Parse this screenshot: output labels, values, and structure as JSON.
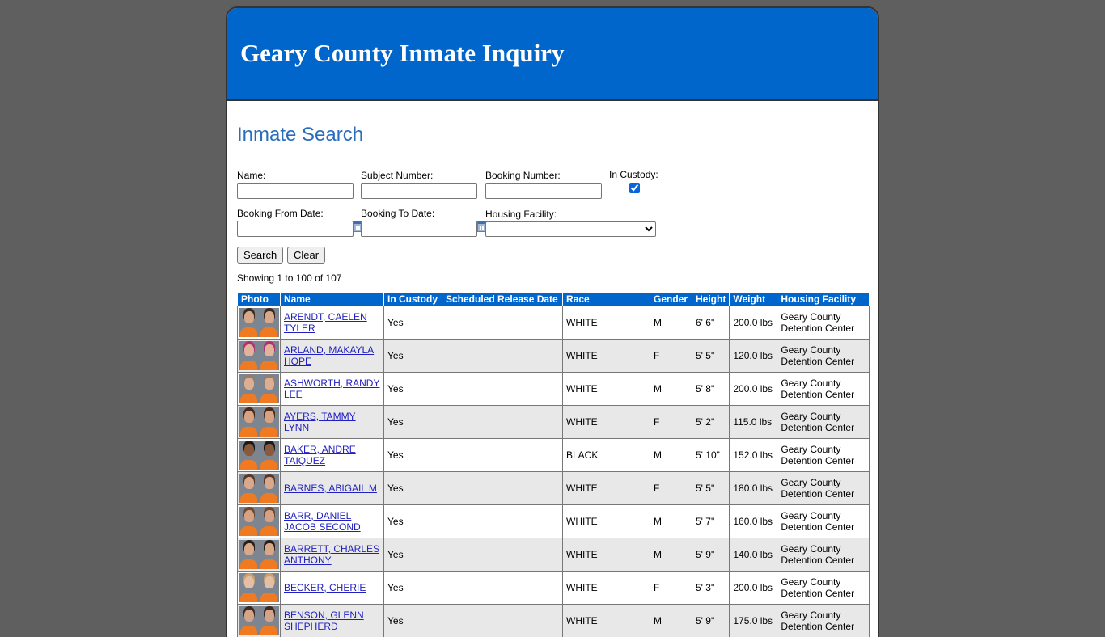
{
  "header": {
    "title": "Geary County Inmate Inquiry"
  },
  "search": {
    "title": "Inmate Search",
    "name_label": "Name:",
    "name_value": "",
    "subject_label": "Subject Number:",
    "subject_value": "",
    "booking_number_label": "Booking Number:",
    "booking_number_value": "",
    "in_custody_label": "In Custody:",
    "in_custody_checked": true,
    "from_date_label": "Booking From Date:",
    "from_date_value": "",
    "to_date_label": "Booking To Date:",
    "to_date_value": "",
    "facility_label": "Housing Facility:",
    "facility_selected": "",
    "search_button": "Search",
    "clear_button": "Clear"
  },
  "results": {
    "summary": "Showing 1 to 100 of 107",
    "columns": [
      "Photo",
      "Name",
      "In Custody",
      "Scheduled Release Date",
      "Race",
      "Gender",
      "Height",
      "Weight",
      "Housing Facility"
    ],
    "rows": [
      {
        "name": "ARENDT, CAELEN TYLER",
        "custody": "Yes",
        "release": "",
        "race": "WHITE",
        "gender": "M",
        "height": "6' 6\"",
        "weight": "200.0 lbs",
        "facility": "Geary County Detention Center"
      },
      {
        "name": "ARLAND, MAKAYLA HOPE",
        "custody": "Yes",
        "release": "",
        "race": "WHITE",
        "gender": "F",
        "height": "5' 5\"",
        "weight": "120.0 lbs",
        "facility": "Geary County Detention Center"
      },
      {
        "name": "ASHWORTH, RANDY LEE",
        "custody": "Yes",
        "release": "",
        "race": "WHITE",
        "gender": "M",
        "height": "5' 8\"",
        "weight": "200.0 lbs",
        "facility": "Geary County Detention Center"
      },
      {
        "name": "AYERS, TAMMY LYNN",
        "custody": "Yes",
        "release": "",
        "race": "WHITE",
        "gender": "F",
        "height": "5' 2\"",
        "weight": "115.0 lbs",
        "facility": "Geary County Detention Center"
      },
      {
        "name": "BAKER, ANDRE TAIQUEZ",
        "custody": "Yes",
        "release": "",
        "race": "BLACK",
        "gender": "M",
        "height": "5' 10\"",
        "weight": "152.0 lbs",
        "facility": "Geary County Detention Center"
      },
      {
        "name": "BARNES, ABIGAIL M",
        "custody": "Yes",
        "release": "",
        "race": "WHITE",
        "gender": "F",
        "height": "5' 5\"",
        "weight": "180.0 lbs",
        "facility": "Geary County Detention Center"
      },
      {
        "name": "BARR, DANIEL JACOB SECOND",
        "custody": "Yes",
        "release": "",
        "race": "WHITE",
        "gender": "M",
        "height": "5' 7\"",
        "weight": "160.0 lbs",
        "facility": "Geary County Detention Center"
      },
      {
        "name": "BARRETT, CHARLES ANTHONY",
        "custody": "Yes",
        "release": "",
        "race": "WHITE",
        "gender": "M",
        "height": "5' 9\"",
        "weight": "140.0 lbs",
        "facility": "Geary County Detention Center"
      },
      {
        "name": "BECKER, CHERIE",
        "custody": "Yes",
        "release": "",
        "race": "WHITE",
        "gender": "F",
        "height": "5' 3\"",
        "weight": "200.0 lbs",
        "facility": "Geary County Detention Center"
      },
      {
        "name": "BENSON, GLENN SHEPHERD",
        "custody": "Yes",
        "release": "",
        "race": "WHITE",
        "gender": "M",
        "height": "5' 9\"",
        "weight": "175.0 lbs",
        "facility": "Geary County Detention Center"
      }
    ]
  },
  "colors": {
    "header_bg": "#0066cc",
    "title_blue": "#2a6ebb",
    "page_bg": "#5f5f5f"
  },
  "icons": {
    "calendar": "calendar-icon",
    "photo": "mugshot-thumbnail"
  }
}
